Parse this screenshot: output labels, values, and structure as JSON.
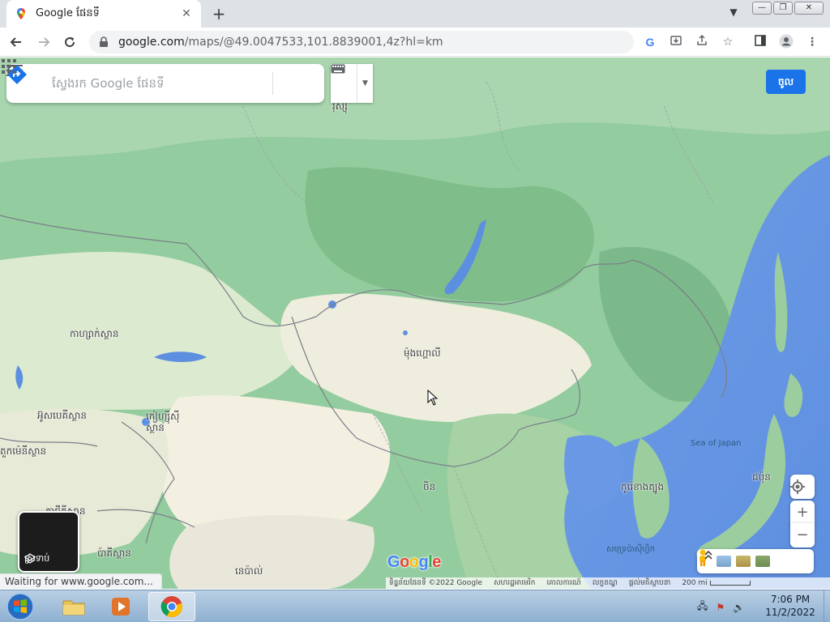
{
  "browser": {
    "tab_title": "Google ផែនទី",
    "tab_close": "✕",
    "new_tab": "+",
    "url_host": "google.com",
    "url_path": "/maps/@49.0047533,101.8839001,4z?hl=km",
    "status_text": "Waiting for www.google.com..."
  },
  "maps": {
    "search_placeholder": "ស្វែងរក Google ផែនទី",
    "signin_label": "ចូល",
    "layers_label": "ស្រទាប់",
    "logo": "Google",
    "attribution": [
      "ទិន្នន័យផែនទី ©2022 Google",
      "សហរដ្ឋអាមេរិក",
      "គោលការណ៍",
      "លក្ខខណ្ឌ",
      "ផ្ដល់មតិស្ថាបនា"
    ],
    "scale_label": "200 mi",
    "zoom_in": "+",
    "zoom_out": "−",
    "labels": {
      "top_edge": "រុស្ស៊ី",
      "kazakhstan": "កាហ្សាក់ស្ថាន",
      "mongolia": "ម៉ុងហ្គោលី",
      "uzbekistan": "អ៊ូសបេគីស្ថាន",
      "kyrgyzstan": "កៀហ្ស៊ីស៊ីស្ថាន",
      "turkmenistan": "តួកម៉េនីស្ថាន",
      "tajikistan": "តាជីគីស្ថាន",
      "pakistan": "ប៉ាគីស្ថាន",
      "nepal": "នេប៉ាល់",
      "china": "ចិន",
      "south_korea": "កូរ៉េខាងត្បូង",
      "japan": "ជប៉ុន",
      "sea_of_japan": "Sea of Japan",
      "pacific": "សមុទ្រប៉ាស៊ីហ្វិក"
    }
  },
  "taskbar": {
    "time": "7:06 PM",
    "date": "11/2/2022"
  }
}
